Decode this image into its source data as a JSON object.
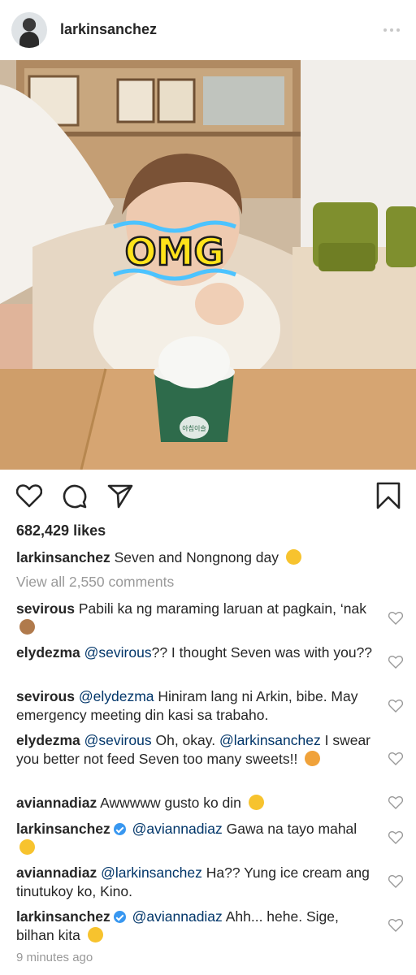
{
  "post": {
    "username": "larkinsanchez",
    "likes": "682,429 likes",
    "caption": {
      "user": "larkinsanchez",
      "text": "Seven and Nongnong day"
    },
    "view_all": "View all 2,550 comments",
    "time": "9 minutes ago"
  },
  "photo": {
    "sticker_text": "OMG",
    "cup_text": "아침이슬"
  },
  "comments": [
    {
      "user": "sevirous",
      "mention": "",
      "text": "Pabili ka ng maraming laruan at pagkain, ‘nak",
      "emoji": "see-no-evil-monkey"
    },
    {
      "user": "elydezma",
      "mention": "@sevirous",
      "text": "?? I thought Seven was with you??",
      "emoji": ""
    },
    {
      "user": "sevirous",
      "mention": "@elydezma",
      "text": "Hiniram lang ni Arkin, bibe. May emergency meeting din kasi sa trabaho.",
      "emoji": ""
    },
    {
      "user": "elydezma",
      "mention": "@sevirous",
      "text": "Oh, okay.",
      "mention2": "@larkinsanchez",
      "text2": "I swear you better not feed Seven too many sweets!!",
      "emoji": "angry-face"
    },
    {
      "user": "aviannadiaz",
      "mention": "",
      "text": "Awwwww gusto ko din",
      "emoji": "pleading-face"
    },
    {
      "user": "larkinsanchez",
      "verified": true,
      "mention": "@aviannadiaz",
      "text": "Gawa na tayo mahal",
      "emoji": "pleading-face"
    },
    {
      "user": "aviannadiaz",
      "mention": "@larkinsanchez",
      "text": "Ha?? Yung ice cream ang tinutukoy ko, Kino.",
      "emoji": ""
    },
    {
      "user": "larkinsanchez",
      "verified": true,
      "mention": "@aviannadiaz",
      "text": "Ahh... hehe. Sige, bilhan kita",
      "emoji": "grinning-sweat-face"
    }
  ],
  "colors": {
    "text": "#262626",
    "muted": "#999999",
    "mention": "#003569",
    "verified": "#3897f0"
  }
}
